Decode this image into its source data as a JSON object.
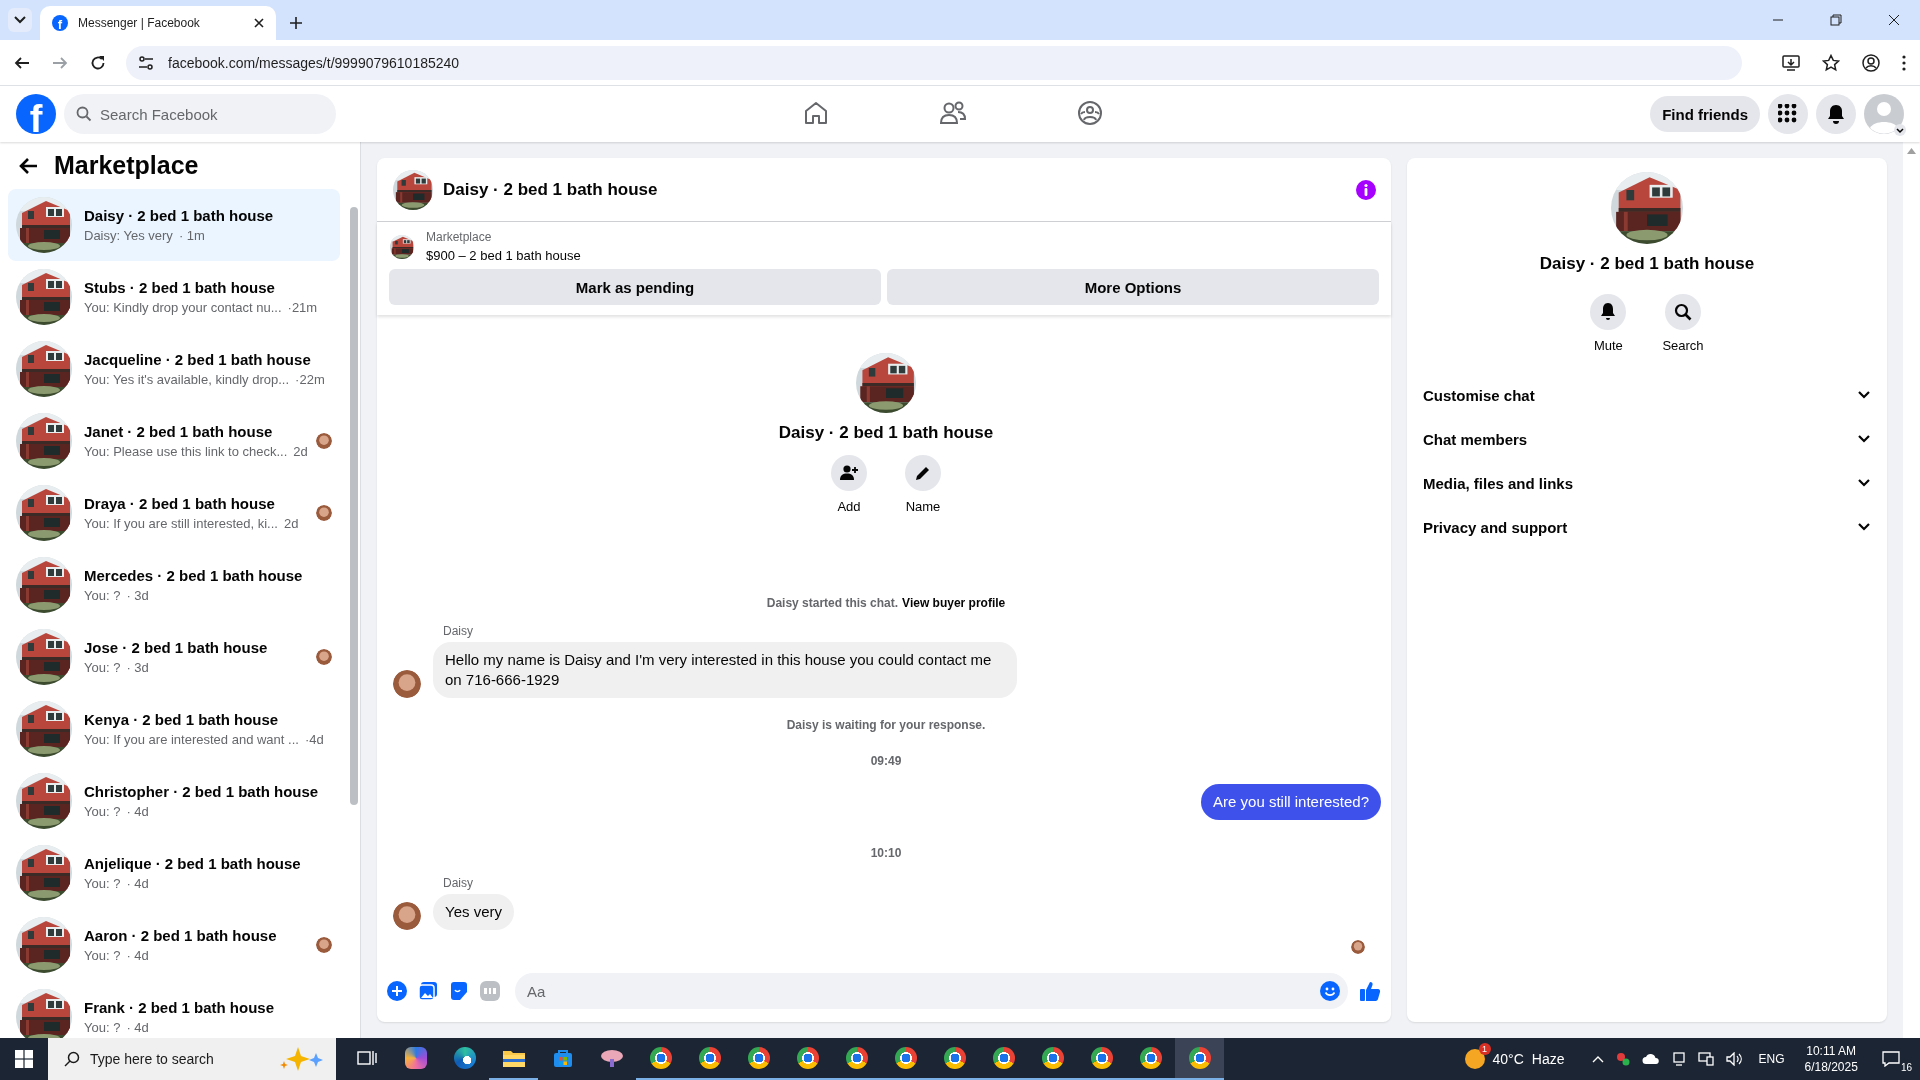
{
  "browser": {
    "tab_title": "Messenger | Facebook",
    "favicon_letter": "f",
    "url": "facebook.com/messages/t/9999079610185240"
  },
  "topbar": {
    "logo_letter": "f",
    "search_placeholder": "Search Facebook",
    "nav": [
      {
        "kind": "home",
        "selected": false
      },
      {
        "kind": "friends",
        "selected": false
      },
      {
        "kind": "groups",
        "selected": false
      }
    ],
    "find_friends": "Find friends"
  },
  "sidebar": {
    "title": "Marketplace",
    "conversations": [
      {
        "title": "Daisy · 2 bed 1 bath house",
        "preview": "Daisy: Yes very",
        "time": "· 1m",
        "selected": true,
        "seen": false
      },
      {
        "title": "Stubs · 2 bed 1 bath house",
        "preview": "You: Kindly drop your contact nu...",
        "time": "·21m",
        "selected": false,
        "seen": false
      },
      {
        "title": "Jacqueline · 2 bed 1 bath house",
        "preview": "You: Yes it's available, kindly drop...",
        "time": "·22m",
        "selected": false,
        "seen": false
      },
      {
        "title": "Janet · 2 bed 1 bath house",
        "preview": "You: Please use this link to check...",
        "time": "2d",
        "selected": false,
        "seen": true
      },
      {
        "title": "Draya · 2 bed 1 bath house",
        "preview": "You: If you are still interested, ki...",
        "time": "2d",
        "selected": false,
        "seen": true
      },
      {
        "title": "Mercedes · 2 bed 1 bath house",
        "preview": "You: ?",
        "time": "· 3d",
        "selected": false,
        "seen": false
      },
      {
        "title": "Jose · 2 bed 1 bath house",
        "preview": "You: ?",
        "time": "· 3d",
        "selected": false,
        "seen": true
      },
      {
        "title": "Kenya · 2 bed 1 bath house",
        "preview": "You: If you are interested and want ...",
        "time": "·4d",
        "selected": false,
        "seen": false
      },
      {
        "title": "Christopher · 2 bed 1 bath house",
        "preview": "You: ?",
        "time": "· 4d",
        "selected": false,
        "seen": false
      },
      {
        "title": "Anjelique · 2 bed 1 bath house",
        "preview": "You: ?",
        "time": "· 4d",
        "selected": false,
        "seen": false
      },
      {
        "title": "Aaron · 2 bed 1 bath house",
        "preview": "You: ?",
        "time": "· 4d",
        "selected": false,
        "seen": true
      },
      {
        "title": "Frank · 2 bed 1 bath house",
        "preview": "You: ?",
        "time": "· 4d",
        "selected": false,
        "seen": false
      }
    ]
  },
  "chat": {
    "title": "Daisy · 2 bed 1 bath house",
    "listing": {
      "label": "Marketplace",
      "text": "$900 – 2 bed 1 bath house"
    },
    "buttons": [
      "Mark as pending",
      "More Options"
    ],
    "intro": {
      "title": "Daisy · 2 bed 1 bath house",
      "actions": [
        {
          "kind": "add",
          "label": "Add"
        },
        {
          "kind": "name",
          "label": "Name"
        }
      ]
    },
    "messages": [
      {
        "kind": "system",
        "text": "Daisy started this chat.",
        "link": "View buyer profile"
      },
      {
        "kind": "sender",
        "text": "Daisy"
      },
      {
        "kind": "incoming",
        "text": "Hello my name is Daisy and I'm very interested in this house you could contact me on 716-666-1929"
      },
      {
        "kind": "system",
        "text": "Daisy is waiting for your response."
      },
      {
        "kind": "time",
        "text": "09:49"
      },
      {
        "kind": "outgoing",
        "text": "Are you still interested?"
      },
      {
        "kind": "time",
        "text": "10:10"
      },
      {
        "kind": "sender",
        "text": "Daisy"
      },
      {
        "kind": "incoming",
        "text": "Yes very"
      },
      {
        "kind": "seen"
      }
    ],
    "composer": {
      "placeholder": "Aa"
    }
  },
  "details": {
    "title": "Daisy · 2 bed 1 bath house",
    "actions": [
      {
        "kind": "mute",
        "label": "Mute"
      },
      {
        "kind": "search",
        "label": "Search"
      }
    ],
    "sections": [
      {
        "label": "Customise chat",
        "expanded": false
      },
      {
        "label": "Chat members",
        "expanded": false
      },
      {
        "label": "Media, files and links",
        "expanded": false
      },
      {
        "label": "Privacy and support",
        "expanded": false
      }
    ]
  },
  "taskbar": {
    "search_placeholder": "Type here to search",
    "apps": [
      {
        "kind": "task_view",
        "running": false,
        "active": false
      },
      {
        "kind": "copilot",
        "running": false,
        "active": false
      },
      {
        "kind": "edge",
        "running": false,
        "active": false
      },
      {
        "kind": "explorer",
        "running": true,
        "active": false
      },
      {
        "kind": "store",
        "running": false,
        "active": false
      },
      {
        "kind": "app",
        "running": false,
        "active": false
      },
      {
        "kind": "chrome",
        "running": true,
        "active": false
      },
      {
        "kind": "chrome",
        "running": true,
        "active": false
      },
      {
        "kind": "chrome",
        "running": true,
        "active": false
      },
      {
        "kind": "chrome",
        "running": true,
        "active": false
      },
      {
        "kind": "chrome",
        "running": true,
        "active": false
      },
      {
        "kind": "chrome",
        "running": true,
        "active": false
      },
      {
        "kind": "chrome",
        "running": true,
        "active": false
      },
      {
        "kind": "chrome",
        "running": true,
        "active": false
      },
      {
        "kind": "chrome",
        "running": true,
        "active": false
      },
      {
        "kind": "chrome",
        "running": true,
        "active": false
      },
      {
        "kind": "chrome",
        "running": true,
        "active": false
      },
      {
        "kind": "chrome",
        "running": true,
        "active": true
      }
    ],
    "weather": {
      "badge": "1",
      "temp": "40°C",
      "condition": "Haze"
    },
    "language": "ENG",
    "time": "10:11 AM",
    "date": "6/18/2025",
    "notifications": "16"
  }
}
